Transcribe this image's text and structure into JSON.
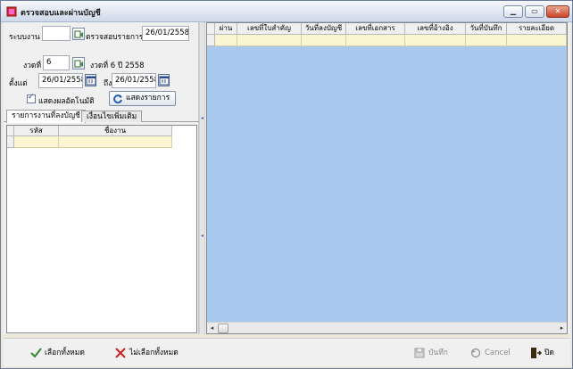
{
  "window": {
    "title": "ตรวจสอบและผ่านบัญชี",
    "controls": [
      "minimize",
      "maximize",
      "close"
    ]
  },
  "filter": {
    "system_label": "ระบบงาน",
    "system_value": "",
    "check_list_label": "ตรวจสอบรายการ",
    "check_list_date": "26/01/2558",
    "period_label": "งวดที่",
    "period_value": "6",
    "period_text": "งวดที่ 6 ปี 2558",
    "from_label": "ตั้งแต่",
    "from_date": "26/01/2558",
    "to_label": "ถึง",
    "to_date": "26/01/2558",
    "auto_show_label": "แสดงผลอัตโนมัติ",
    "auto_show_checked": true,
    "show_button": "แสดงรายการ"
  },
  "tabs": [
    {
      "label": "รายการงานที่ลงบัญชี",
      "active": true
    },
    {
      "label": "เงื่อนไขเพิ่มเติม",
      "active": false
    }
  ],
  "left_grid": {
    "columns": [
      "รหัส",
      "ชื่องาน"
    ]
  },
  "right_grid": {
    "columns": [
      "ผ่าน",
      "เลขที่ใบสำคัญ",
      "วันที่ลงบัญชี",
      "เลขที่เอกสาร",
      "เลขที่อ้างอิง",
      "วันที่บันทึก",
      "รายละเอียด"
    ]
  },
  "footer": {
    "select_all": "เลือกทั้งหมด",
    "deselect_all": "ไม่เลือกทั้งหมด",
    "save": "บันทึก",
    "cancel": "Cancel",
    "close": "ปิด"
  },
  "colors": {
    "grid_background": "#a8c9ed",
    "row_highlight": "#fbf5d2",
    "select_all_icon": "#2e8b2e",
    "deselect_icon": "#d02020"
  }
}
